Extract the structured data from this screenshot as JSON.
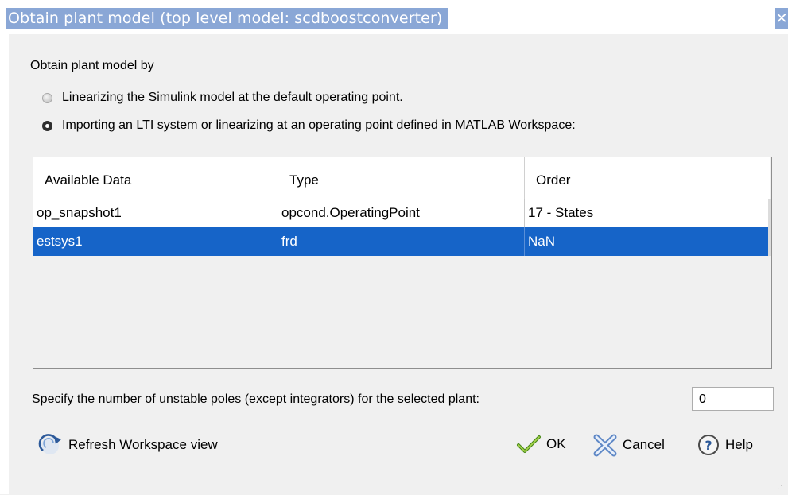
{
  "window": {
    "title": "Obtain plant model (top level model: scdboostconverter)",
    "close_glyph": "✕"
  },
  "prompt": "Obtain plant model by",
  "options": [
    {
      "label": "Linearizing the Simulink model at the default operating point.",
      "selected": false
    },
    {
      "label": "Importing an LTI system or linearizing at an operating point defined in MATLAB Workspace:",
      "selected": true
    }
  ],
  "table": {
    "columns": [
      "Available Data",
      "Type",
      "Order"
    ],
    "rows": [
      {
        "name": "op_snapshot1",
        "type": "opcond.OperatingPoint",
        "order": "17 - States",
        "selected": false
      },
      {
        "name": "estsys1",
        "type": "frd",
        "order": "NaN",
        "selected": true
      }
    ]
  },
  "unstable_poles": {
    "label": "Specify the number of unstable poles (except integrators) for the selected plant:",
    "value": "0"
  },
  "buttons": {
    "refresh": "Refresh Workspace view",
    "ok": "OK",
    "cancel": "Cancel",
    "help": "Help"
  },
  "colors": {
    "title_highlight": "#8aa7d6",
    "selection": "#1664c8"
  },
  "icons": {
    "refresh": "refresh-icon",
    "ok": "checkmark-icon",
    "cancel": "cancel-x-icon",
    "help": "help-question-icon"
  }
}
